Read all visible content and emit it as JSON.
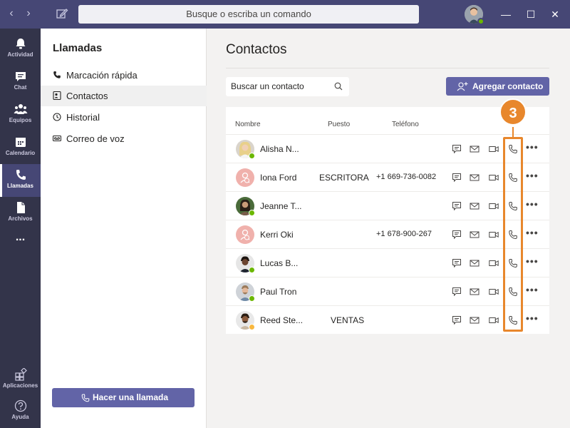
{
  "titlebar": {
    "search_placeholder": "Busque o escriba un comando"
  },
  "rail": {
    "items": [
      {
        "label": "Actividad",
        "icon": "bell-icon"
      },
      {
        "label": "Chat",
        "icon": "chat-icon"
      },
      {
        "label": "Equipos",
        "icon": "teams-icon"
      },
      {
        "label": "Calendario",
        "icon": "calendar-icon"
      },
      {
        "label": "Llamadas",
        "icon": "phone-icon"
      },
      {
        "label": "Archivos",
        "icon": "files-icon"
      },
      {
        "label": "...",
        "icon": "more-icon"
      },
      {
        "label": "Aplicaciones",
        "icon": "apps-icon"
      },
      {
        "label": "Ayuda",
        "icon": "help-icon"
      }
    ],
    "active": "Llamadas"
  },
  "leftpane": {
    "title": "Llamadas",
    "items": [
      {
        "label": "Marcación rápida",
        "icon": "phone-icon"
      },
      {
        "label": "Contactos",
        "icon": "contact-card-icon"
      },
      {
        "label": "Historial",
        "icon": "clock-icon"
      },
      {
        "label": "Correo de voz",
        "icon": "voicemail-icon"
      }
    ],
    "active": "Contactos",
    "call_button": "Hacer una llamada"
  },
  "main": {
    "title": "Contactos",
    "search_placeholder": "Buscar un contacto",
    "add_button": "Agregar contacto",
    "columns": {
      "name": "Nombre",
      "job": "Puesto",
      "phone": "Teléfono"
    },
    "contacts": [
      {
        "name": "Alisha N...",
        "job": "",
        "phone": "",
        "presence": "available"
      },
      {
        "name": "Iona Ford",
        "job": "ESCRITORA",
        "phone": "+1 669-736-0082",
        "presence": "none"
      },
      {
        "name": "Jeanne T...",
        "job": "",
        "phone": "",
        "presence": "available"
      },
      {
        "name": "Kerri Oki",
        "job": "",
        "phone": "+1 678-900-267",
        "presence": "none"
      },
      {
        "name": "Lucas B...",
        "job": "",
        "phone": "",
        "presence": "available"
      },
      {
        "name": "Paul Tron",
        "job": "",
        "phone": "",
        "presence": "available"
      },
      {
        "name": "Reed Ste...",
        "job": "VENTAS",
        "phone": "",
        "presence": "away"
      }
    ]
  },
  "callout": {
    "number": "3"
  },
  "colors": {
    "accent": "#6264a7",
    "titlebar": "#464775",
    "rail": "#33344a",
    "callout": "#e8872c",
    "available": "#6bb700",
    "away": "#f8b73e"
  }
}
